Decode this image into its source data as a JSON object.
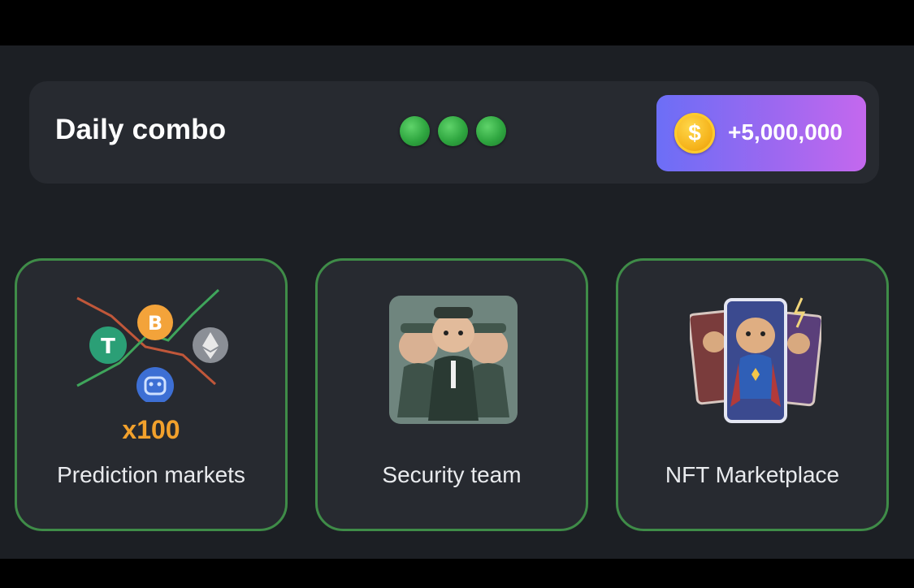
{
  "combo": {
    "title": "Daily combo",
    "dots_filled": 3,
    "dot_color": "#2fa640",
    "reward": {
      "amount": "+5,000,000",
      "icon": "coin-icon",
      "coin_symbol": "$"
    }
  },
  "cards": [
    {
      "label": "Prediction markets",
      "badge": "x100",
      "icon": "crypto-chart-icon"
    },
    {
      "label": "Security team",
      "icon": "hamster-guards-image"
    },
    {
      "label": "NFT Marketplace",
      "icon": "hamster-cards-image"
    }
  ],
  "colors": {
    "background": "#1c1f24",
    "card": "#272a30",
    "card_border": "#3f8c48",
    "reward_gradient_start": "#6c6ef6",
    "reward_gradient_end": "#c468ee",
    "badge": "#f2a12c"
  }
}
